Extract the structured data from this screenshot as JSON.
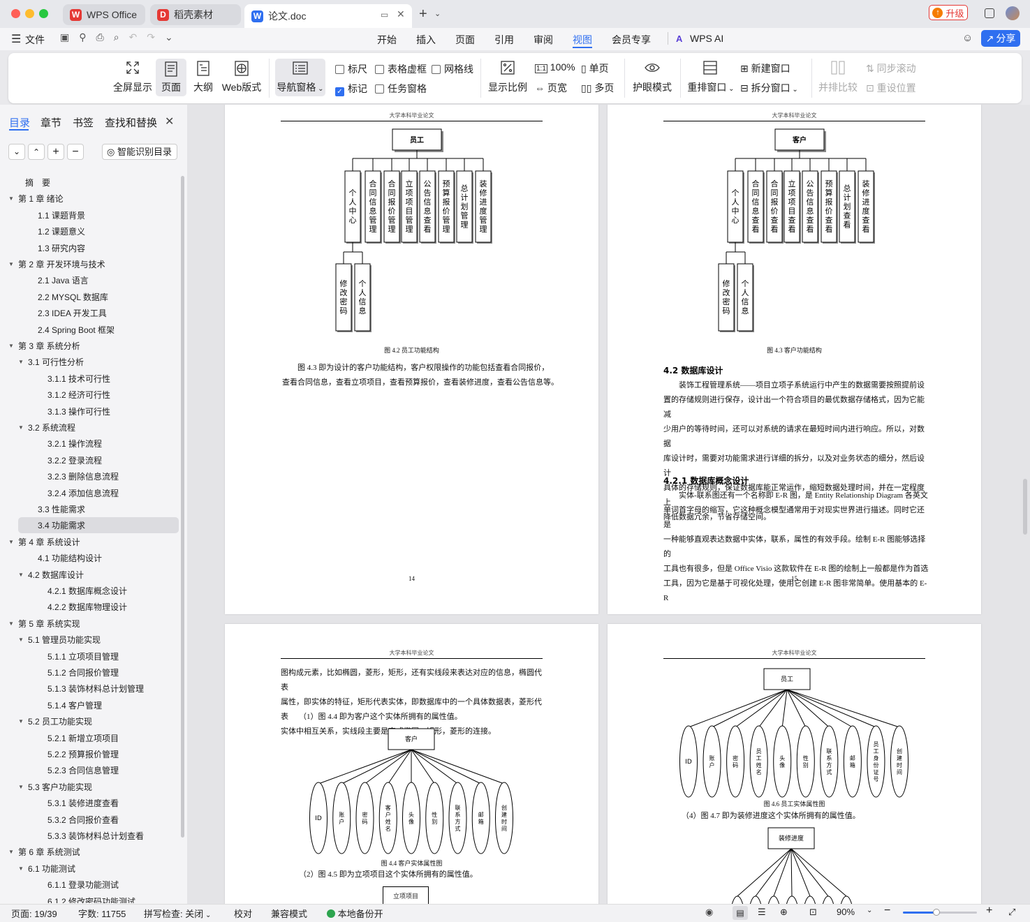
{
  "tabs": [
    {
      "label": "WPS Office"
    },
    {
      "label": "稻壳素材"
    },
    {
      "label": "论文.doc"
    }
  ],
  "titlebar": {
    "upgrade": "升级"
  },
  "menu": {
    "file": "文件",
    "items": [
      "开始",
      "插入",
      "页面",
      "引用",
      "审阅",
      "视图",
      "会员专享"
    ],
    "ai": "WPS AI",
    "share": "分享"
  },
  "ribbon": {
    "fullscreen": "全屏显示",
    "page": "页面",
    "outline": "大纲",
    "web": "Web版式",
    "navpane": "导航窗格",
    "ruler": "标尺",
    "table_grid": "表格虚框",
    "gridlines": "网格线",
    "markup": "标记",
    "task_pane": "任务窗格",
    "zoom": "显示比例",
    "hundred": "100%",
    "page_width": "页宽",
    "single": "单页",
    "multi": "多页",
    "eye": "护眼模式",
    "arrange": "重排窗口",
    "new_window": "新建窗口",
    "split": "拆分窗口",
    "compare": "并排比较",
    "sync_scroll": "同步滚动",
    "reset_pos": "重设位置"
  },
  "sidebar": {
    "tabs": [
      "目录",
      "章节",
      "书签",
      "查找和替换"
    ],
    "smart_toc": "智能识别目录",
    "toc": [
      {
        "label": "摘　要",
        "level": 0
      },
      {
        "label": "第 1 章  绪论",
        "level": 0,
        "caret": true
      },
      {
        "label": "1.1  课题背景",
        "level": 1
      },
      {
        "label": "1.2  课题意义",
        "level": 1
      },
      {
        "label": "1.3  研究内容",
        "level": 1
      },
      {
        "label": "第 2 章  开发环境与技术",
        "level": 0,
        "caret": true
      },
      {
        "label": "2.1 Java 语言",
        "level": 1
      },
      {
        "label": "2.2 MYSQL 数据库",
        "level": 1
      },
      {
        "label": "2.3 IDEA 开发工具",
        "level": 1
      },
      {
        "label": "2.4 Spring Boot 框架",
        "level": 1
      },
      {
        "label": "第 3 章  系统分析",
        "level": 0,
        "caret": true
      },
      {
        "label": "3.1  可行性分析",
        "level": 1,
        "caret": true
      },
      {
        "label": "3.1.1  技术可行性",
        "level": 2
      },
      {
        "label": "3.1.2  经济可行性",
        "level": 2
      },
      {
        "label": "3.1.3  操作可行性",
        "level": 2
      },
      {
        "label": "3.2  系统流程",
        "level": 1,
        "caret": true
      },
      {
        "label": "3.2.1  操作流程",
        "level": 2
      },
      {
        "label": "3.2.2  登录流程",
        "level": 2
      },
      {
        "label": "3.2.3  删除信息流程",
        "level": 2
      },
      {
        "label": "3.2.4  添加信息流程",
        "level": 2
      },
      {
        "label": "3.3  性能需求",
        "level": 1
      },
      {
        "label": "3.4  功能需求",
        "level": 1,
        "selected": true
      },
      {
        "label": "第 4 章  系统设计",
        "level": 0,
        "caret": true
      },
      {
        "label": "4.1  功能结构设计",
        "level": 1
      },
      {
        "label": "4.2  数据库设计",
        "level": 1,
        "caret": true
      },
      {
        "label": "4.2.1  数据库概念设计",
        "level": 2
      },
      {
        "label": "4.2.2  数据库物理设计",
        "level": 2
      },
      {
        "label": "第 5 章  系统实现",
        "level": 0,
        "caret": true
      },
      {
        "label": "5.1  管理员功能实现",
        "level": 1,
        "caret": true
      },
      {
        "label": "5.1.1  立项项目管理",
        "level": 2
      },
      {
        "label": "5.1.2  合同报价管理",
        "level": 2
      },
      {
        "label": "5.1.3  装饰材料总计划管理",
        "level": 2
      },
      {
        "label": "5.1.4  客户管理",
        "level": 2
      },
      {
        "label": "5.2  员工功能实现",
        "level": 1,
        "caret": true
      },
      {
        "label": "5.2.1  新增立项项目",
        "level": 2
      },
      {
        "label": "5.2.2  预算报价管理",
        "level": 2
      },
      {
        "label": "5.2.3  合同信息管理",
        "level": 2
      },
      {
        "label": "5.3  客户功能实现",
        "level": 1,
        "caret": true
      },
      {
        "label": "5.3.1  装修进度查看",
        "level": 2
      },
      {
        "label": "5.3.2  合同报价查看",
        "level": 2
      },
      {
        "label": "5.3.3  装饰材料总计划查看",
        "level": 2
      },
      {
        "label": "第 6 章  系统测试",
        "level": 0,
        "caret": true
      },
      {
        "label": "6.1  功能测试",
        "level": 1,
        "caret": true
      },
      {
        "label": "6.1.1  登录功能测试",
        "level": 2
      },
      {
        "label": "6.1.2  修改密码功能测试",
        "level": 2
      }
    ]
  },
  "doc": {
    "header": "大学本科毕业论文",
    "p14": {
      "root": "员工",
      "children": [
        "个人中心",
        "合同信息管理",
        "合同报价管理",
        "立项项目管理",
        "公告信息查看",
        "预算报价管理",
        "总计划管理",
        "装修进度管理"
      ],
      "sub": [
        "修改密码",
        "个人信息"
      ],
      "caption": "图 4.2  员工功能结构",
      "para": [
        "图 4.3 即为设计的客户功能结构，客户权限操作的功能包括查看合同报价，",
        "查看合同信息，查看立项项目，查看预算报价，查看装修进度，查看公告信息等。"
      ],
      "num": "14"
    },
    "p15": {
      "root": "客户",
      "children": [
        "个人中心",
        "合同信息查看",
        "合同报价查看",
        "立项项目查看",
        "公告信息查看",
        "预算报价查看",
        "总计划查看",
        "装修进度查看"
      ],
      "sub": [
        "修改密码",
        "个人信息"
      ],
      "caption": "图 4.3  客户功能结构",
      "h42": "4.2  数据库设计",
      "para1": [
        "装饰工程管理系统——项目立项子系统运行中产生的数据需要按照提前设",
        "置的存储规则进行保存，设计出一个符合项目的最优数据存储格式，因为它能减",
        "少用户的等待时间，还可以对系统的请求在最短时间内进行响应。所以，对数据",
        "库设计时，需要对功能需求进行详细的拆分，以及对业务状态的细分，然后设计",
        "具体的存储规则，保证数据库能正常运作，缩短数据处理时间，并在一定程度上",
        "降低数据冗余，节省存储空间。"
      ],
      "h421": "4.2.1  数据库概念设计",
      "para2": [
        "实体-联系图还有一个名称即 E-R 图，是 Entity Relationship Diagram 各英文",
        "单词首字母的缩写，它这种概念模型通常用于对现实世界进行描述。同时它还是",
        "一种能够直观表达数据中实体，联系，属性的有效手段。绘制 E-R 图能够选择的",
        "工具也有很多，但是 Office Visio 这款软件在 E-R 图的绘制上一般都是作为首选",
        "工具，因为它是基于可视化处理，使用它创建 E-R 图非常简单。使用基本的 E-R"
      ],
      "num": "15"
    },
    "p16": {
      "para": [
        "图构成元素，比如椭圆，菱形，矩形，还有实线段来表达对应的信息，椭圆代表",
        "属性，即实体的特征，矩形代表实体，即数据库中的一个具体数据表，菱形代表",
        "实体中相互关系，实线段主要是完成椭圆，矩形，菱形的连接。"
      ],
      "item1": "（1）图 4.4 即为客户这个实体所拥有的属性值。",
      "entity": "客户",
      "attrs": [
        "ID",
        "账户",
        "密码",
        "客户姓名",
        "头像",
        "性别",
        "联系方式",
        "邮箱",
        "创建时间"
      ],
      "caption": "图 4.4  客户实体属性图",
      "item2": "（2）图 4.5 即为立项项目这个实体所拥有的属性值。",
      "entity2": "立项项目"
    },
    "p17": {
      "entity": "员工",
      "attrs": [
        "ID",
        "账户",
        "密码",
        "员工姓名",
        "头像",
        "性别",
        "联系方式",
        "邮箱",
        "员工身份证号",
        "创建时间"
      ],
      "caption": "图 4.6  员工实体属性图",
      "item4": "（4）图 4.7 即为装修进度这个实体所拥有的属性值。",
      "entity2": "装修进度"
    }
  },
  "status": {
    "page": "页面: 19/39",
    "words": "字数: 11755",
    "spell": "拼写检查: 关闭",
    "proof": "校对",
    "compat": "兼容模式",
    "backup": "本地备份开",
    "zoom": "90%"
  }
}
